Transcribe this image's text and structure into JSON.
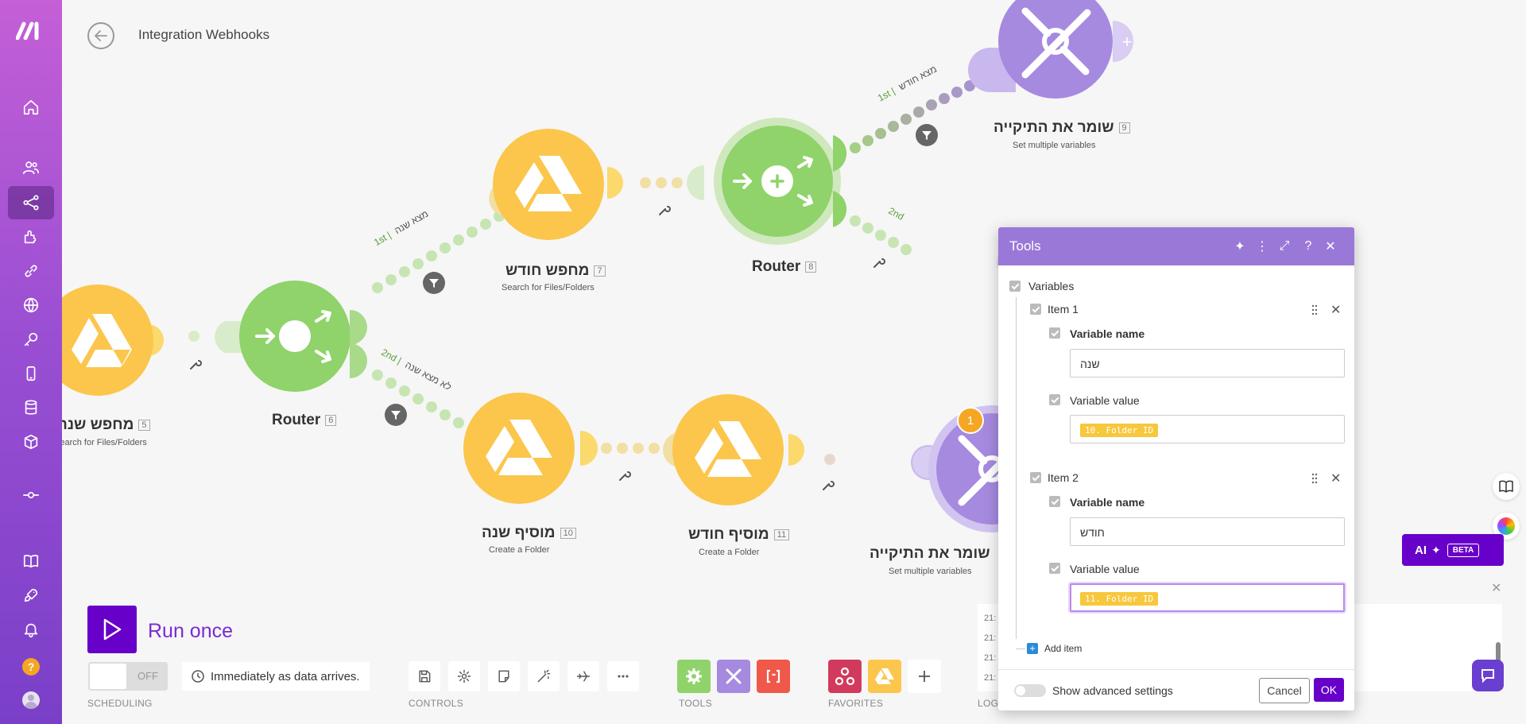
{
  "header": {
    "title": "Integration Webhooks"
  },
  "sidebar": {
    "items": [
      {
        "name": "home"
      },
      {
        "name": "team"
      },
      {
        "name": "scenarios"
      },
      {
        "name": "templates"
      },
      {
        "name": "connections"
      },
      {
        "name": "webhooks"
      },
      {
        "name": "keys"
      },
      {
        "name": "devices"
      },
      {
        "name": "data-stores"
      },
      {
        "name": "data-structures"
      },
      {
        "name": "custom-apps"
      },
      {
        "name": "help"
      },
      {
        "name": "whats-new"
      },
      {
        "name": "notifications"
      }
    ],
    "help_glyph": "?"
  },
  "modules": [
    {
      "id": "m5",
      "title": "מחפש שנה",
      "num": "5",
      "subtitle": "Search for Files/Folders",
      "app": "google-drive"
    },
    {
      "id": "m6",
      "title": "Router",
      "num": "6",
      "subtitle": "",
      "app": "router"
    },
    {
      "id": "m7",
      "title": "מחפש חודש",
      "num": "7",
      "subtitle": "Search for Files/Folders",
      "app": "google-drive"
    },
    {
      "id": "m8",
      "title": "Router",
      "num": "8",
      "subtitle": "",
      "app": "router"
    },
    {
      "id": "m9",
      "title": "שומר את התיקייה",
      "num": "9",
      "subtitle": "Set multiple variables",
      "app": "tools"
    },
    {
      "id": "m10",
      "title": "מוסיף שנה",
      "num": "10",
      "subtitle": "Create a Folder",
      "app": "google-drive"
    },
    {
      "id": "m11",
      "title": "מוסיף חודש",
      "num": "11",
      "subtitle": "Create a Folder",
      "app": "google-drive"
    },
    {
      "id": "m12",
      "title": "שומר את התיקייה",
      "num": "",
      "subtitle": "Set multiple variables",
      "app": "tools",
      "badge": "1"
    }
  ],
  "routes": [
    {
      "order": "1st",
      "label": "מצא שנה"
    },
    {
      "order": "2nd",
      "label": "לא מצא שנה"
    },
    {
      "order": "1st",
      "label": "מצא חודש"
    },
    {
      "order": "2nd",
      "label": ""
    }
  ],
  "run": {
    "label": "Run once"
  },
  "scheduling": {
    "toggle": "OFF",
    "value": "Immediately as data arrives.",
    "caption": "SCHEDULING"
  },
  "captions": {
    "controls": "CONTROLS",
    "tools": "TOOLS",
    "favorites": "FAVORITES",
    "log": "LOG"
  },
  "panel": {
    "title": "Tools",
    "section": "Variables",
    "items": [
      {
        "label": "Item 1",
        "name_label": "Variable name",
        "name_value": "שנה",
        "value_label": "Variable value",
        "value_pill": "10. Folder ID"
      },
      {
        "label": "Item 2",
        "name_label": "Variable name",
        "name_value": "חודש",
        "value_label": "Variable value",
        "value_pill": "11. Folder ID"
      }
    ],
    "add_item": "Add item",
    "advanced": "Show advanced settings",
    "cancel": "Cancel",
    "ok": "OK"
  },
  "log_rows": [
    "21:",
    "21:",
    "21:",
    "21:"
  ],
  "ai": {
    "label": "AI",
    "beta": "BETA"
  },
  "colors": {
    "accent": "#6700c8",
    "drive": "#fbc64b",
    "router": "#8fd36a",
    "tools": "#a58ae0"
  }
}
